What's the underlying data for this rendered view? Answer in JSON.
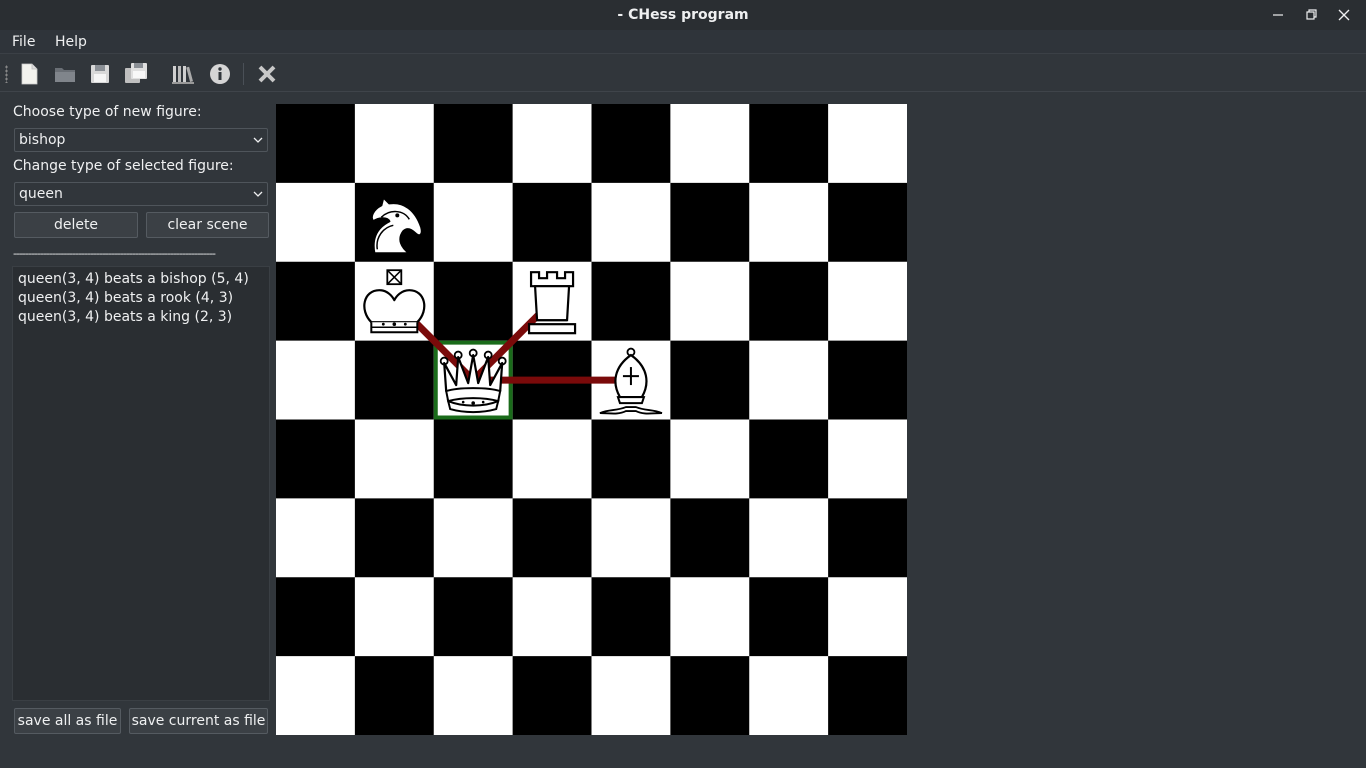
{
  "window": {
    "title": "- CHess program"
  },
  "menubar": {
    "items": [
      "File",
      "Help"
    ]
  },
  "toolbar": {
    "icons": [
      "new-file-icon",
      "open-folder-icon",
      "save-icon",
      "save-all-icon",
      "library-icon",
      "info-icon",
      "close-icon"
    ]
  },
  "sidebar": {
    "new_figure_label": "Choose type of new figure:",
    "new_figure_value": "bishop",
    "change_figure_label": "Change type of selected figure:",
    "change_figure_value": "queen",
    "delete_label": "delete",
    "clear_label": "clear scene",
    "separator": "--------------------------------------------------------------------",
    "log": [
      "queen(3, 4) beats a bishop (5, 4)",
      "queen(3, 4) beats a rook (4, 3)",
      "queen(3, 4) beats a king (2, 3)"
    ],
    "save_all_label": "save all as file",
    "save_current_label": "save current as file"
  },
  "board": {
    "size": 8,
    "colors": {
      "dark": "#000000",
      "light": "#ffffff",
      "selection": "#1a6b1a",
      "attack": "#7a0a0a"
    },
    "pieces": [
      {
        "type": "knight",
        "col": 2,
        "row": 2
      },
      {
        "type": "king",
        "col": 2,
        "row": 3
      },
      {
        "type": "rook",
        "col": 4,
        "row": 3
      },
      {
        "type": "queen",
        "col": 3,
        "row": 4,
        "selected": true
      },
      {
        "type": "bishop",
        "col": 5,
        "row": 4
      }
    ],
    "attacks": [
      {
        "from": [
          3,
          4
        ],
        "to": [
          2,
          3
        ]
      },
      {
        "from": [
          3,
          4
        ],
        "to": [
          4,
          3
        ]
      },
      {
        "from": [
          3,
          4
        ],
        "to": [
          5,
          4
        ]
      }
    ]
  }
}
